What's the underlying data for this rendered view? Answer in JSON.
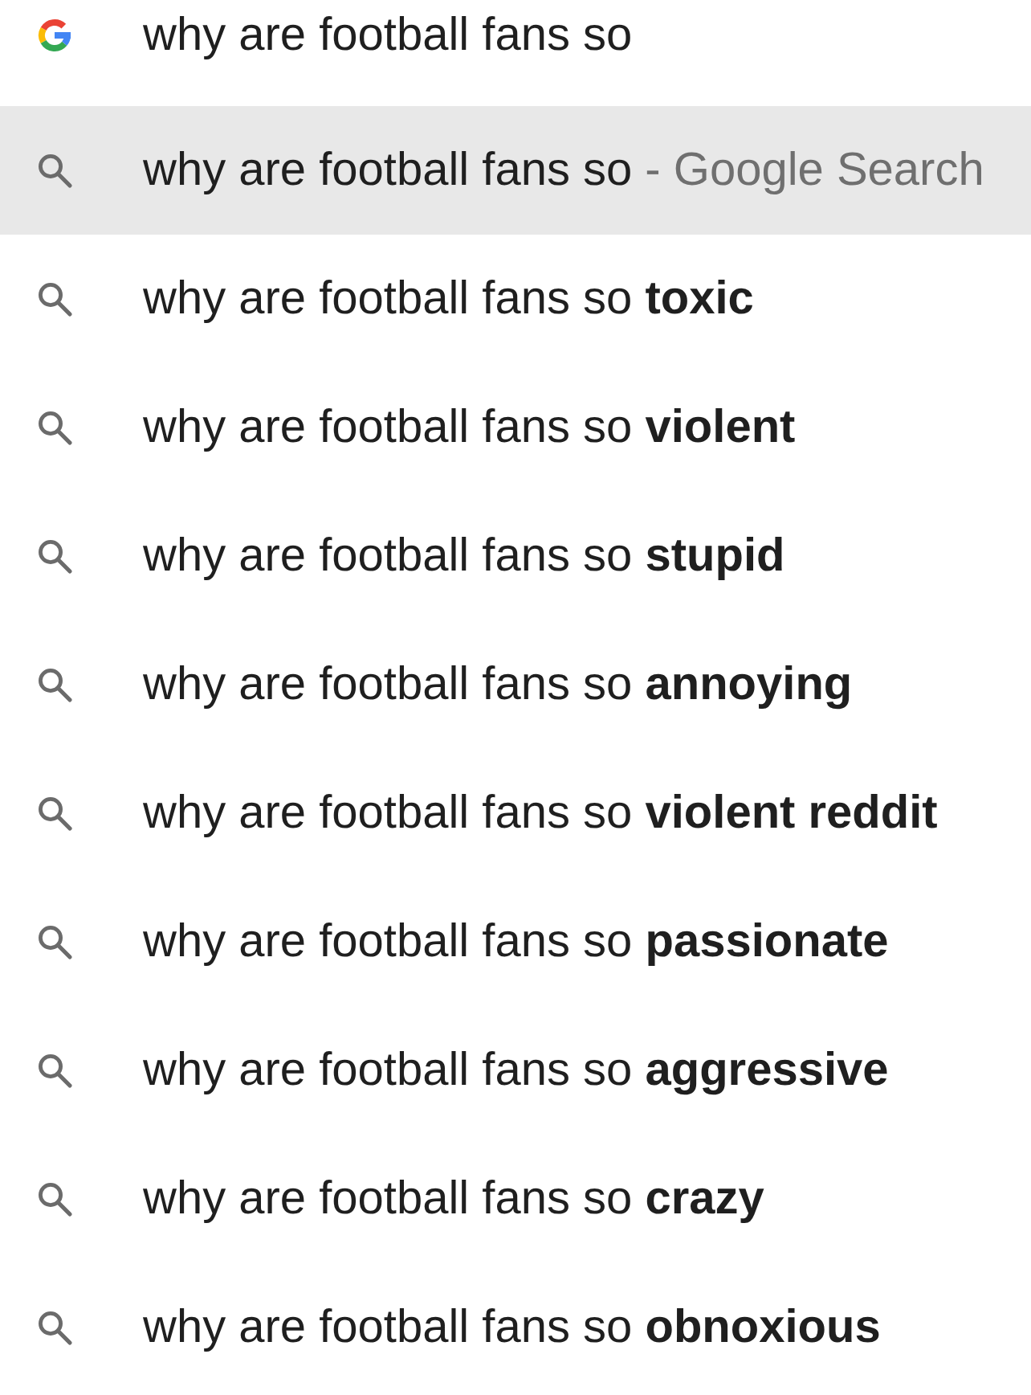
{
  "omnibox": {
    "value": "why are football fans so"
  },
  "suggestions": [
    {
      "text": "why are football fans so",
      "suffix": "- Google Search",
      "selected": true
    },
    {
      "text": "why are football fans so **toxic**",
      "selected": false
    },
    {
      "text": "why are football fans so **violent**",
      "selected": false
    },
    {
      "text": "why are football fans so **stupid**",
      "selected": false
    },
    {
      "text": "why are football fans so **annoying**",
      "selected": false
    },
    {
      "text": "why are football fans so **violent reddit**",
      "selected": false
    },
    {
      "text": "why are football fans so **passionate**",
      "selected": false
    },
    {
      "text": "why are football fans so **aggressive**",
      "selected": false
    },
    {
      "text": "why are football fans so **crazy**",
      "selected": false
    },
    {
      "text": "why are football fans so **obnoxious**",
      "selected": false
    }
  ]
}
